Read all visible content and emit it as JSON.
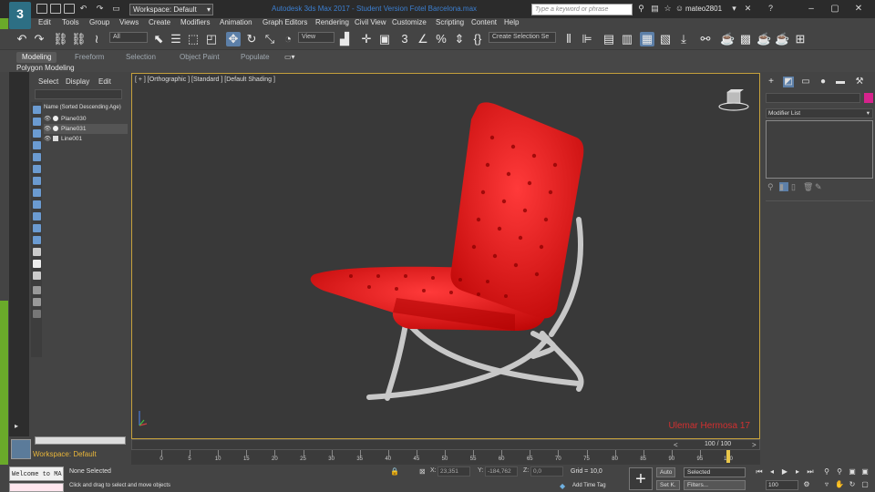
{
  "titlebar": {
    "logo_text": "3",
    "workspace_select": "Workspace: Default",
    "title": "Autodesk 3ds Max 2017 - Student Version    Fotel Barcelona.max",
    "search_placeholder": "Type a keyword or phrase",
    "user": "mateo2801"
  },
  "menu": [
    "Edit",
    "Tools",
    "Group",
    "Views",
    "Create",
    "Modifiers",
    "Animation",
    "Graph Editors",
    "Rendering",
    "Civil View",
    "Customize",
    "Scripting",
    "Content",
    "Help"
  ],
  "toolbar": {
    "selection_filter": "All",
    "ref_coord": "View",
    "named_sel": "Create Selection Se"
  },
  "ribbon": {
    "tabs": [
      "Modeling",
      "Freeform",
      "Selection",
      "Object Paint",
      "Populate"
    ],
    "active_tab": "Modeling",
    "panel_label": "Polygon Modeling"
  },
  "explorer": {
    "tabs": [
      "Select",
      "Display",
      "Edit"
    ],
    "header": "Name (Sorted Descending Age)",
    "rows": [
      {
        "name": "Plane030",
        "selected": false
      },
      {
        "name": "Plane031",
        "selected": true
      },
      {
        "name": "Line001",
        "selected": false
      }
    ],
    "workspace_label": "Workspace: Default"
  },
  "viewport": {
    "label": "[ + ] [Orthographic ] [Standard ] [Default Shading ]",
    "watermark": "Ulemar Hermosa 17"
  },
  "command_panel": {
    "modifier_list": "Modifier List",
    "object_color": "#d6238c"
  },
  "timeline": {
    "frame_label": "100 / 100",
    "current_frame": 100,
    "ticks": [
      0,
      5,
      10,
      15,
      20,
      25,
      30,
      35,
      40,
      45,
      50,
      55,
      60,
      65,
      70,
      75,
      80,
      85,
      90,
      95,
      100
    ]
  },
  "status": {
    "maxscript": "Welcome to MA",
    "selection": "None Selected",
    "prompt": "Click and drag to select and move objects",
    "x_label": "X:",
    "x_value": "23,351",
    "y_label": "Y:",
    "y_value": "-184,762",
    "z_label": "Z:",
    "z_value": "0,0",
    "grid": "Grid = 10,0",
    "add_time_tag": "Add Time Tag",
    "auto_btn": "Auto",
    "selected_select": "Selected",
    "setk_btn": "Set K.",
    "filters_btn": "Filters...",
    "frame_field": "100"
  },
  "colors": {
    "viewport_border": "#c6a13c",
    "accent_green": "#6aaa2a",
    "chair_red": "#e01818"
  }
}
